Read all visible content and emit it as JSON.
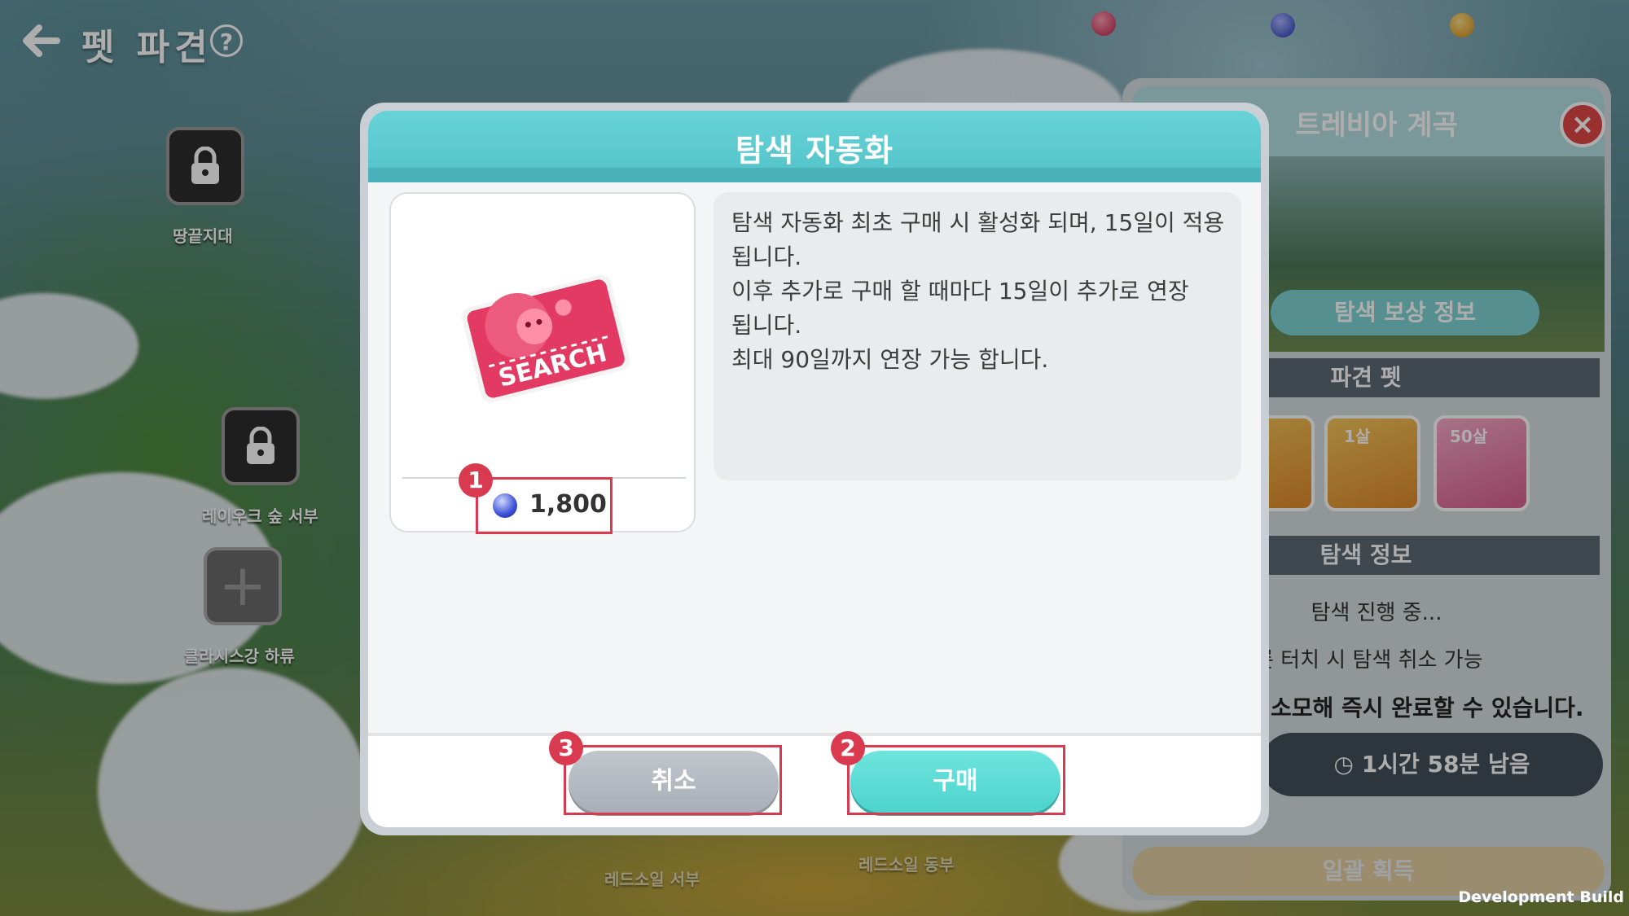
{
  "header": {
    "back_icon": "arrow-left-icon",
    "title": "펫 파견",
    "help_symbol": "?"
  },
  "map": {
    "nodes": [
      {
        "label": "땅끝지대",
        "locked": true
      },
      {
        "label": "레이우크 숲 서부",
        "locked": true
      },
      {
        "label": "클라시스강 하류",
        "locked": false
      }
    ],
    "faded_labels": [
      "레드소일 서부",
      "레드소일 동부"
    ]
  },
  "side_panel": {
    "title": "트레비아 계곡",
    "close_symbol": "×",
    "reward_info_button": "탐색 보상 정보",
    "dispatch_pets_header": "파견 펫",
    "pets": [
      {
        "age": ""
      },
      {
        "age": "1살"
      },
      {
        "age": "50살"
      }
    ],
    "search_info_header": "탐색 정보",
    "status_text": "탐색 진행 중...",
    "cancel_hint": "롯 터치 시 탐색 취소 가능",
    "tooltip": "소모해 즉시 완료할 수 있습니다.",
    "timer": "1시간 58분 남음",
    "collect_button": "일괄 획득"
  },
  "dialog": {
    "title": "탐색 자동화",
    "item_icon": "search-ticket-icon",
    "item_card_text": "SEARCH",
    "price": "1,800",
    "price_icon": "sapphire-gem-icon",
    "description_lines": [
      "탐색 자동화 최초 구매 시 활성화 되며, 15일이 적용",
      "됩니다.",
      "이후 추가로 구매 할 때마다 15일이 추가로 연장",
      "됩니다.",
      "최대 90일까지 연장 가능 합니다."
    ],
    "cancel_button": "취소",
    "buy_button": "구매"
  },
  "annotations": {
    "marker_price": "1",
    "marker_buy": "2",
    "marker_cancel": "3"
  },
  "footer": {
    "build_label": "Development Build"
  },
  "colors": {
    "dialog_header": "#5ecbd0",
    "buy_button": "#5fdcd6",
    "cancel_button": "#b5bac1",
    "highlight": "#d93a4f",
    "close_button": "#e04848"
  }
}
